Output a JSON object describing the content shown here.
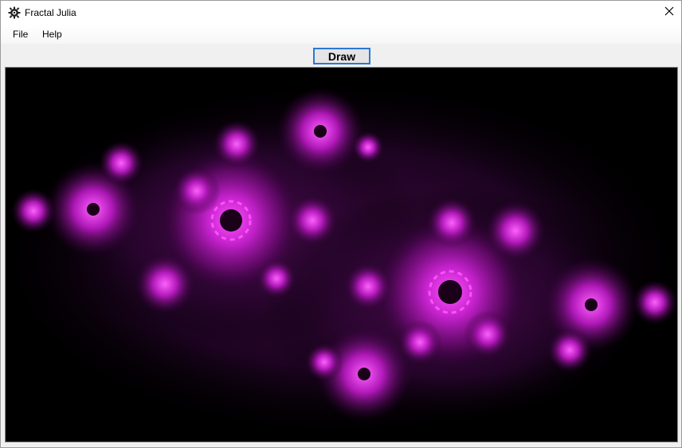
{
  "window": {
    "title": "Fractal Julia",
    "app_icon": "gear-icon",
    "close_icon": "close-icon"
  },
  "menu": {
    "items": [
      {
        "label": "File"
      },
      {
        "label": "Help"
      }
    ]
  },
  "toolbar": {
    "draw_label": "Draw"
  },
  "canvas": {
    "colors": {
      "background": "#000000",
      "dark_halo": "#1a0018",
      "mid_glow": "#5a0a5e",
      "bright_glow": "#c020c8",
      "core": "#ff40ff"
    }
  }
}
